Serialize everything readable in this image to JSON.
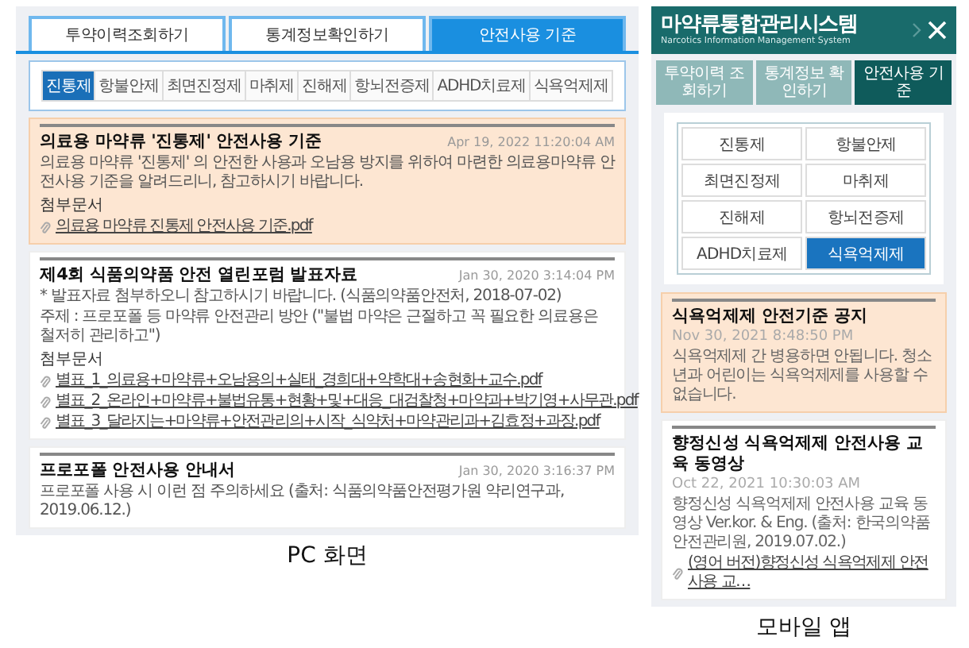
{
  "pc": {
    "tabs": [
      {
        "label": "투약이력조회하기",
        "selected": false
      },
      {
        "label": "통계정보확인하기",
        "selected": false
      },
      {
        "label": "안전사용 기준",
        "selected": true
      }
    ],
    "categories": [
      {
        "label": "진통제",
        "selected": true
      },
      {
        "label": "항불안제",
        "selected": false
      },
      {
        "label": "최면진정제",
        "selected": false
      },
      {
        "label": "마취제",
        "selected": false
      },
      {
        "label": "진해제",
        "selected": false
      },
      {
        "label": "항뇌전증제",
        "selected": false
      },
      {
        "label": "ADHD치료제",
        "selected": false
      },
      {
        "label": "식욕억제제",
        "selected": false
      }
    ],
    "posts": [
      {
        "title": "의료용 마약류 '진통제' 안전사용 기준",
        "date": "Apr 19, 2022 11:20:04 AM",
        "highlighted": true,
        "body": [
          "의료용 마약류 '진통제' 의 안전한 사용과 오남용 방지를 위하여 마련한 의료용마약류 안전사용 기준을 알려드리니, 참고하시기 바랍니다."
        ],
        "attachments_label": "첨부문서",
        "files": [
          "의료용 마약류 진통제 안전사용 기준.pdf"
        ]
      },
      {
        "title": "제4회 식품의약품 안전 열린포럼 발표자료",
        "date": "Jan 30, 2020 3:14:04 PM",
        "highlighted": false,
        "body": [
          "* 발표자료 첨부하오니 참고하시기 바랍니다. (식품의약품안전처, 2018-07-02)",
          "주제 : 프로포폴 등 마약류 안전관리 방안 (\"불법 마약은 근절하고 꼭 필요한 의료용은 철저히 관리하고\")"
        ],
        "attachments_label": "첨부문서",
        "files": [
          "별표_1_의료용+마약류+오남용의+실태_경희대+약학대+송현화+교수.pdf",
          "별표_2_온라인+마약류+불법유통+현황+및+대응_대검찰청+마약과+박기영+사무관.pdf",
          "별표_3_달라지는+마약류+안전관리의+시작_식약처+마약관리과+김효정+과장.pdf"
        ]
      },
      {
        "title": "프로포폴 안전사용 안내서",
        "date": "Jan 30, 2020 3:16:37 PM",
        "highlighted": false,
        "body": [
          "프로포폴 사용 시 이런 점 주의하세요 (출처: 식품의약품안전평가원 약리연구과, 2019.06.12.)"
        ]
      }
    ],
    "caption": "PC 화면"
  },
  "mobile": {
    "header": {
      "title": "마약류통합관리시스템",
      "subtitle": "Narcotics Information Management System"
    },
    "tabs": [
      {
        "label": "투약이력 조회하기",
        "selected": false
      },
      {
        "label": "통계정보 확인하기",
        "selected": false
      },
      {
        "label": "안전사용 기준",
        "selected": true
      }
    ],
    "categories": [
      {
        "label": "진통제",
        "selected": false
      },
      {
        "label": "항불안제",
        "selected": false
      },
      {
        "label": "최면진정제",
        "selected": false
      },
      {
        "label": "마취제",
        "selected": false
      },
      {
        "label": "진해제",
        "selected": false
      },
      {
        "label": "항뇌전증제",
        "selected": false
      },
      {
        "label": "ADHD치료제",
        "selected": false
      },
      {
        "label": "식욕억제제",
        "selected": true
      }
    ],
    "posts": [
      {
        "title": "식욕억제제 안전기준 공지",
        "date": "Nov 30, 2021 8:48:50 PM",
        "highlighted": true,
        "body": "식욕억제제 간 병용하면 안됩니다. 청소년과 어린이는 식욕억제제를 사용할 수 없습니다."
      },
      {
        "title": "향정신성 식욕억제제 안전사용 교육 동영상",
        "date": "Oct 22, 2021 10:30:03 AM",
        "highlighted": false,
        "body": "향정신성 식욕억제제 안전사용 교육 동영상 Ver.kor. & Eng. (출처: 한국의약품안전관리원, 2019.07.02.)",
        "files": [
          "(영어 버전)향정신성 식욕억제제 안전사용 교…"
        ]
      }
    ],
    "caption": "모바일 앱"
  }
}
